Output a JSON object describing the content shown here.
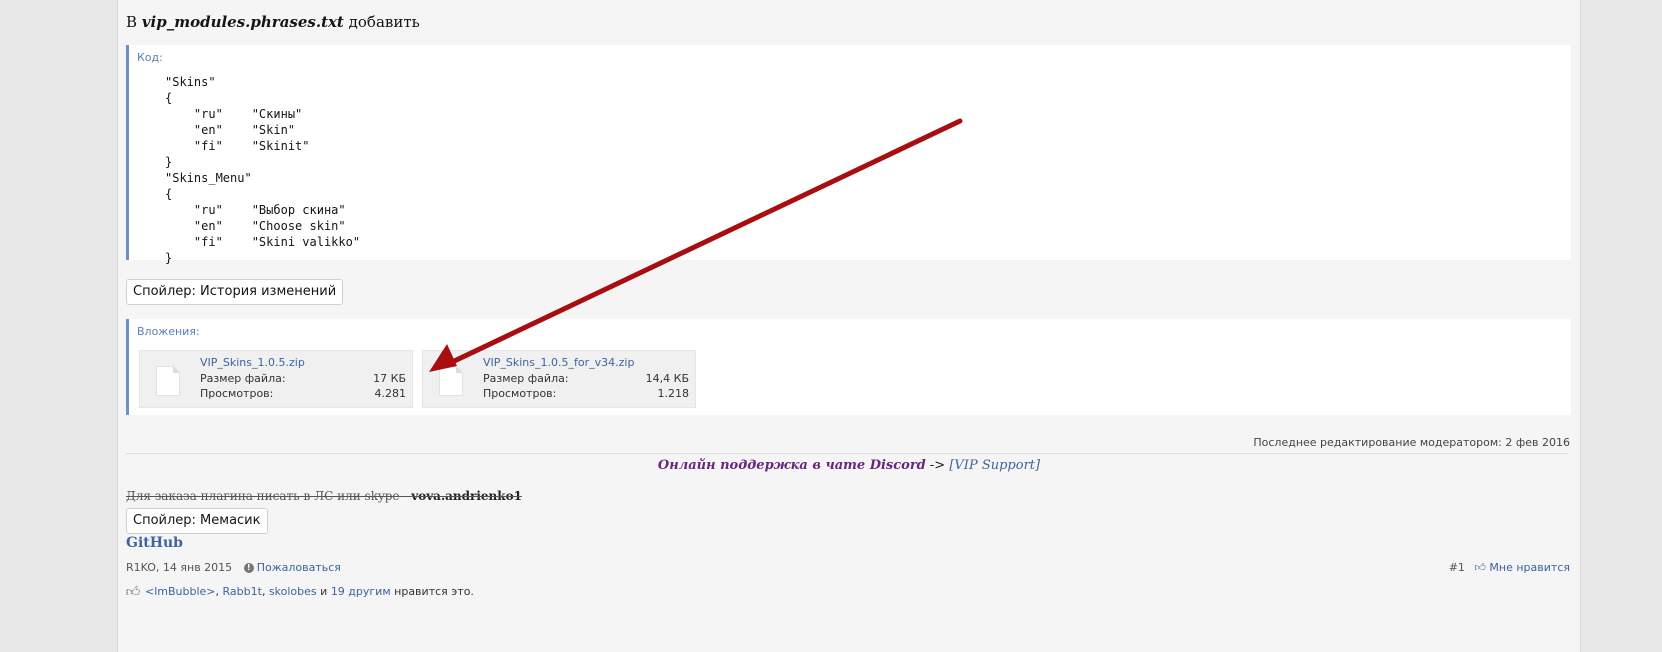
{
  "intro": {
    "prefix": "В",
    "filename": "vip_modules.phrases.txt",
    "suffix": "добавить"
  },
  "code_block": {
    "title": "Код:",
    "text": "\"Skins\"\n{\n    \"ru\"    \"Скины\"\n    \"en\"    \"Skin\"\n    \"fi\"    \"Skinit\"\n}\n\"Skins_Menu\"\n{\n    \"ru\"    \"Выбор скина\"\n    \"en\"    \"Choose skin\"\n    \"fi\"    \"Skini valikko\"\n}"
  },
  "spoiler_history": "Спойлер: История изменений",
  "attachments": {
    "title": "Вложения:",
    "size_label": "Размер файла:",
    "views_label": "Просмотров:",
    "files": [
      {
        "name": "VIP_Skins_1.0.5.zip",
        "size": "17 КБ",
        "views": "4.281"
      },
      {
        "name": "VIP_Skins_1.0.5_for_v34.zip",
        "size": "14,4 КБ",
        "views": "1.218"
      }
    ]
  },
  "edited": "Последнее редактирование модератором: 2 фев 2016",
  "support": {
    "part1": "Онлайн поддержка в чате Discord",
    "arrow": " -> ",
    "link": "[VIP Support]"
  },
  "strike": {
    "text": "Для заказа плагина писать в ЛС или skype - ",
    "contact": "vova.andrienko1"
  },
  "spoiler_memes": "Спойлер: Мемасик",
  "signature_link": "GitHub",
  "meta": {
    "author_date": "R1KO, 14 янв 2015",
    "report": "Пожаловаться",
    "post_number": "#1",
    "like": "Мне нравится"
  },
  "likes": {
    "user1": "<lmBubble>",
    "user2": "Rabb1t",
    "user3": "skolobes",
    "and": "и",
    "others": "19 другим",
    "tail": "нравится это."
  },
  "annotation": {
    "arrow_color": "#a80d10"
  }
}
